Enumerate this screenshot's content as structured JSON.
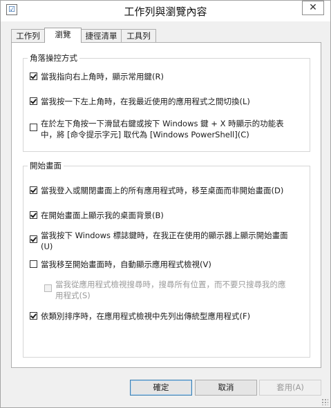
{
  "window": {
    "title": "工作列與瀏覽內容",
    "close_glyph": "✕",
    "app_icon_glyph": "☑"
  },
  "tabs": [
    {
      "label": "工作列",
      "active": false
    },
    {
      "label": "瀏覽",
      "active": true
    },
    {
      "label": "捷徑清單",
      "active": false
    },
    {
      "label": "工具列",
      "active": false
    }
  ],
  "corner_group": {
    "title": "角落操控方式",
    "options": [
      {
        "label": "當我指向右上角時，顯示常用鍵(R)",
        "checked": true,
        "enabled": true
      },
      {
        "label": "當我按一下左上角時，在我最近使用的應用程式之間切換(L)",
        "checked": true,
        "enabled": true
      },
      {
        "line1": "在於左下角按一下滑鼠右鍵或按下 Windows 鍵 + X 時顯示的功能表",
        "line2": "中，將 [命令提示字元] 取代為 [Windows PowerShell](C)",
        "checked": false,
        "enabled": true
      }
    ]
  },
  "start_group": {
    "title": "開始畫面",
    "options": [
      {
        "label": "當我登入或關閉畫面上的所有應用程式時，移至桌面而非開始畫面(D)",
        "checked": true,
        "enabled": true
      },
      {
        "label": "在開始畫面上顯示我的桌面背景(B)",
        "checked": true,
        "enabled": true
      },
      {
        "line1": "當我按下 Windows 標誌鍵時，在我正在使用的顯示器上顯示開始畫面",
        "line2": "(U)",
        "checked": true,
        "enabled": true
      },
      {
        "label": "當我移至開始畫面時，自動顯示應用程式檢視(V)",
        "checked": false,
        "enabled": true
      },
      {
        "line1": "當我從應用程式檢視搜尋時，搜尋所有位置，而不要只搜尋我的應",
        "line2": "用程式(S)",
        "checked": false,
        "enabled": false
      },
      {
        "label": "依類別排序時，在應用程式檢視中先列出傳統型應用程式(F)",
        "checked": true,
        "enabled": true
      }
    ]
  },
  "buttons": {
    "ok": "確定",
    "cancel": "取消",
    "apply": "套用(A)"
  }
}
